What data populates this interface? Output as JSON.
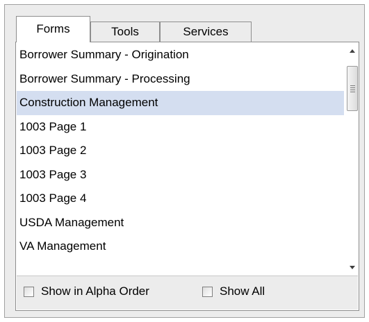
{
  "tabs": [
    {
      "label": "Forms",
      "active": true
    },
    {
      "label": "Tools",
      "active": false
    },
    {
      "label": "Services",
      "active": false
    }
  ],
  "forms_list": {
    "items": [
      "Borrower Summary - Origination",
      "Borrower Summary - Processing",
      "Construction Management",
      "1003 Page 1",
      "1003 Page 2",
      "1003 Page 3",
      "1003 Page 4",
      "USDA Management",
      "VA Management"
    ],
    "selected": "Construction Management"
  },
  "options": {
    "show_alpha_label": "Show in Alpha Order",
    "show_alpha_checked": false,
    "show_all_label": "Show All",
    "show_all_checked": false
  },
  "colors": {
    "selection": "#d4def0",
    "panel": "#ececec"
  }
}
